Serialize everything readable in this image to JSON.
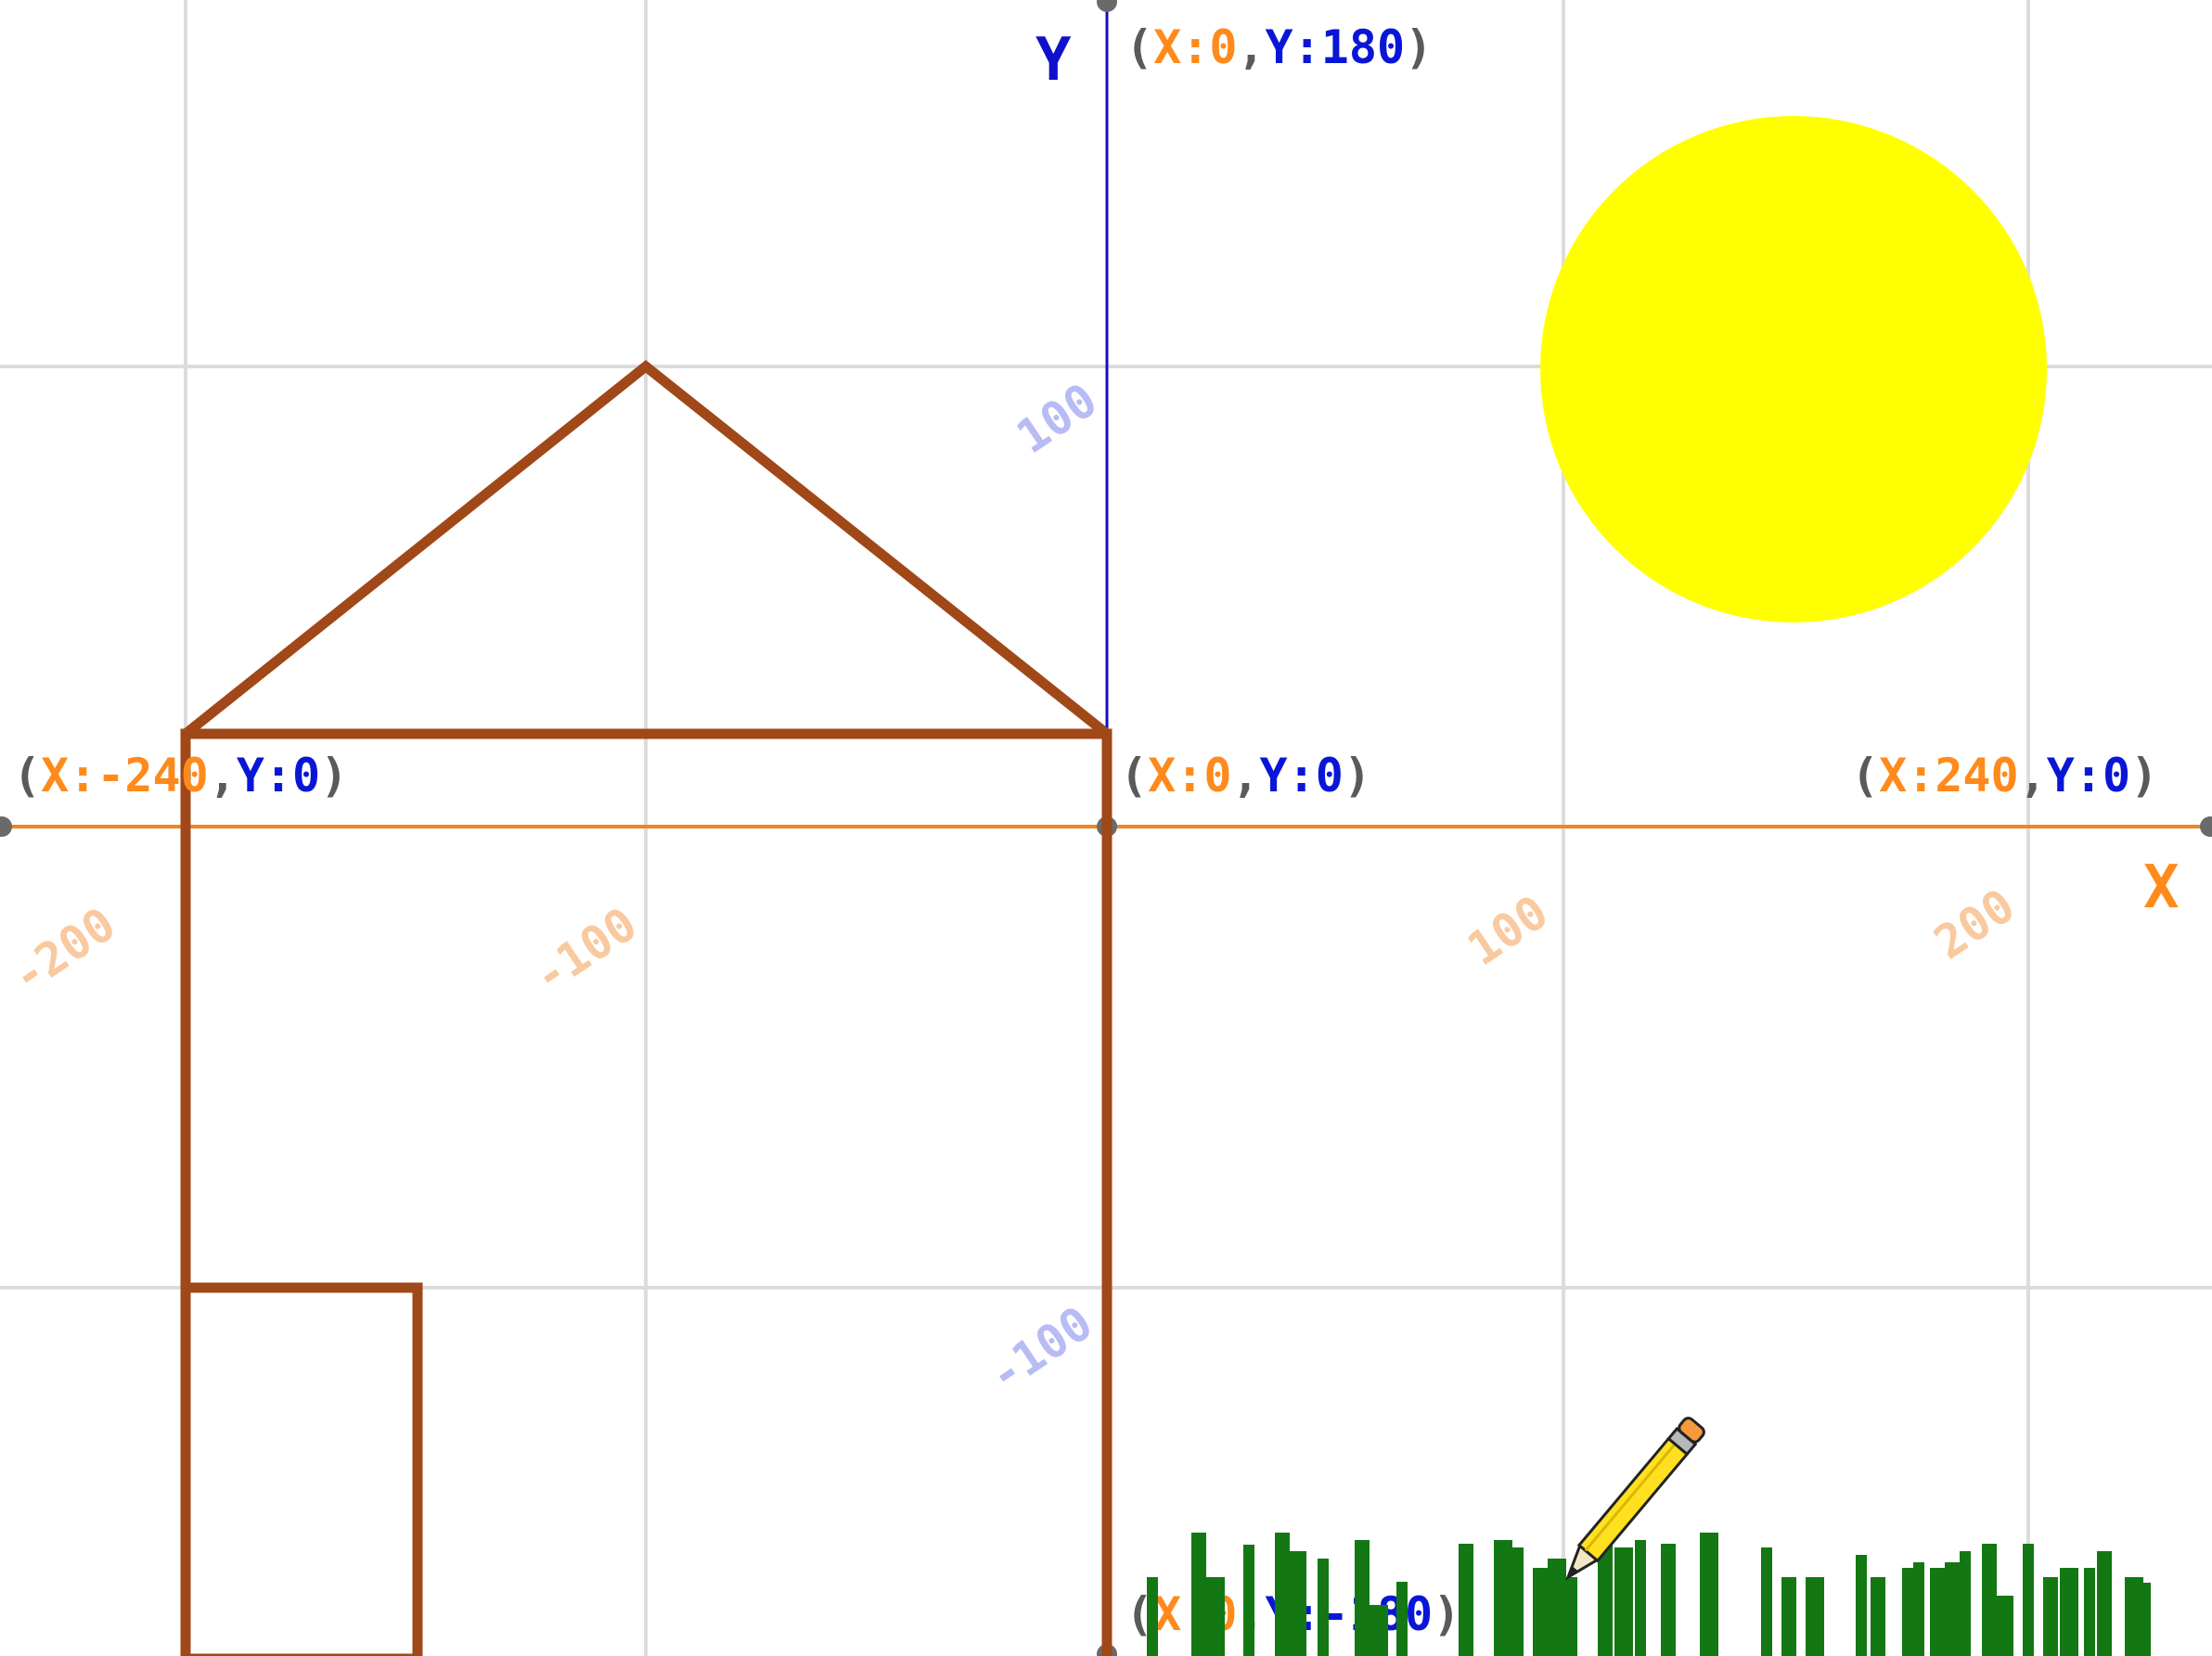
{
  "stage": {
    "background": "#ffffff",
    "grid_color": "#dcdcdc",
    "x_axis_color": "#f2861e",
    "y_axis_color": "#1010cc",
    "paren_color": "#5a5a5a",
    "x_value_color": "#ff8a1c",
    "y_value_color": "#0a16d6",
    "x_tick_color": "#f9c9a0",
    "y_tick_color": "#b8bcf5"
  },
  "axes": {
    "x_label": "X",
    "y_label": "Y"
  },
  "ticks": {
    "x": [
      "-200",
      "-100",
      "100",
      "200"
    ],
    "y": [
      "100",
      "-100"
    ]
  },
  "coordinate_labels": [
    {
      "open": "(",
      "x": "X:-240",
      "comma": ",",
      "y": "Y:0",
      "close": ")"
    },
    {
      "open": "(",
      "x": "X:0",
      "comma": ",",
      "y": "Y:0",
      "close": ")"
    },
    {
      "open": "(",
      "x": "X:240",
      "comma": ",",
      "y": "Y:0",
      "close": ")"
    },
    {
      "open": "(",
      "x": "X:0",
      "comma": ",",
      "y": "Y:180",
      "close": ")"
    },
    {
      "open": "(",
      "x": "X:0",
      "comma": ",",
      "y": "Y:-180",
      "close": ")"
    }
  ],
  "drawing": {
    "house_color": "#a04818",
    "sun_color": "#ffff00",
    "grass_color": "#137813",
    "pencil": {
      "body": "#ffe020",
      "eraser": "#f59a3c",
      "band": "#b8b8b8",
      "tip": "#222222"
    }
  }
}
